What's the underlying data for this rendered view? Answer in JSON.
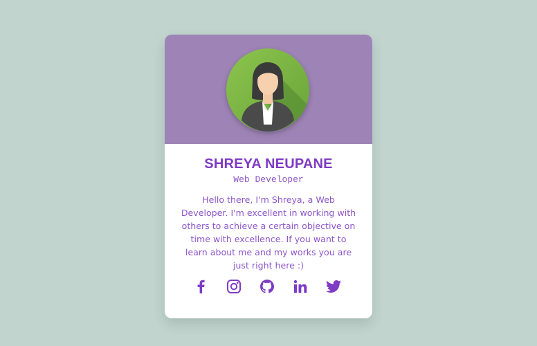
{
  "profile": {
    "name": "SHREYA NEUPANE",
    "role": "Web Developer",
    "bio": "Hello there, I'm Shreya, a Web Developer. I'm excellent in working with others to achieve a certain objective on time with excellence. If you want to learn about me and my works you are just right here :)"
  },
  "social": [
    {
      "icon": "facebook-icon"
    },
    {
      "icon": "instagram-icon"
    },
    {
      "icon": "github-icon"
    },
    {
      "icon": "linkedin-icon"
    },
    {
      "icon": "twitter-icon"
    }
  ],
  "colors": {
    "background": "#c1d4ce",
    "header": "#9e84b6",
    "accent": "#7e3bc4"
  }
}
